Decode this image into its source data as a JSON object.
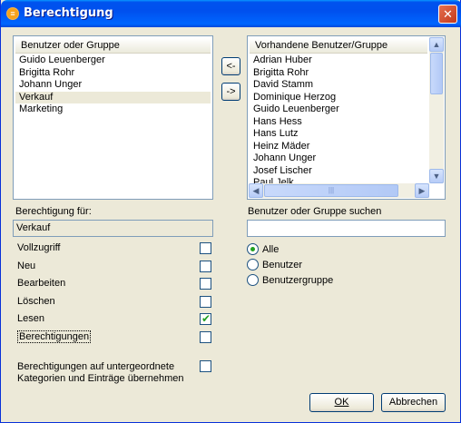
{
  "window": {
    "title": "Berechtigung",
    "close_glyph": "✕"
  },
  "left_list": {
    "header": "Benutzer oder Gruppe",
    "items": [
      "Guido Leuenberger",
      "Brigitta Rohr",
      "Johann Unger",
      "Verkauf",
      "Marketing"
    ],
    "selected_index": 3
  },
  "right_list": {
    "header": "Vorhandene Benutzer/Gruppe",
    "items": [
      "Adrian Huber",
      "Brigitta Rohr",
      "David Stamm",
      "Dominique Herzog",
      "Guido Leuenberger",
      "Hans Hess",
      "Hans Lutz",
      "Heinz Mäder",
      "Johann Unger",
      "Josef Lischer",
      "Paul Jelk"
    ]
  },
  "move_buttons": {
    "add_label": "<-",
    "remove_label": "->"
  },
  "permission_for": {
    "label": "Berechtigung für:",
    "value": "Verkauf"
  },
  "search": {
    "label": "Benutzer oder Gruppe suchen",
    "value": ""
  },
  "permissions": [
    {
      "label": "Vollzugriff",
      "checked": false
    },
    {
      "label": "Neu",
      "checked": false
    },
    {
      "label": "Bearbeiten",
      "checked": false
    },
    {
      "label": "Löschen",
      "checked": false
    },
    {
      "label": "Lesen",
      "checked": true
    },
    {
      "label": "Berechtigungen",
      "checked": false,
      "focused": true
    }
  ],
  "inherit": {
    "line1": "Berechtigungen auf untergeordnete",
    "line2": "Kategorien und Einträge übernehmen",
    "checked": false
  },
  "filter": {
    "options": [
      "Alle",
      "Benutzer",
      "Benutzergruppe"
    ],
    "selected": "Alle"
  },
  "footer": {
    "ok_label": "OK",
    "cancel_label": "Abbrechen"
  },
  "icons": {
    "app": "app-icon",
    "close": "close-icon",
    "scroll_up": "▲",
    "scroll_down": "▼",
    "scroll_left": "◀",
    "scroll_right": "▶",
    "check": "✔",
    "grip": "|||"
  }
}
